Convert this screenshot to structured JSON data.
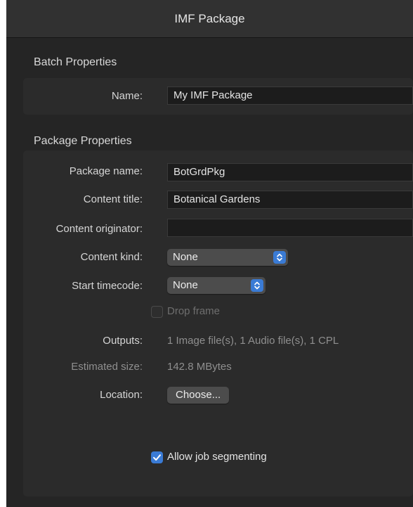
{
  "window": {
    "title": "IMF Package"
  },
  "batch": {
    "header": "Batch Properties",
    "name_label": "Name:",
    "name_value": "My IMF Package"
  },
  "package": {
    "header": "Package Properties",
    "package_name_label": "Package name:",
    "package_name_value": "BotGrdPkg",
    "content_title_label": "Content title:",
    "content_title_value": "Botanical Gardens",
    "content_originator_label": "Content originator:",
    "content_originator_value": "",
    "content_kind_label": "Content kind:",
    "content_kind_value": "None",
    "start_timecode_label": "Start timecode:",
    "start_timecode_value": "None",
    "drop_frame_label": "Drop frame",
    "drop_frame_checked": false,
    "outputs_label": "Outputs:",
    "outputs_value": "1 Image file(s), 1 Audio file(s), 1 CPL",
    "estimated_size_label": "Estimated size:",
    "estimated_size_value": "142.8 MBytes",
    "location_label": "Location:",
    "choose_button_label": "Choose...",
    "allow_segmenting_label": "Allow job segmenting",
    "allow_segmenting_checked": true
  },
  "colors": {
    "accent": "#3a7bd5",
    "background": "#252525",
    "panel": "#2b2b2b"
  },
  "icons": {
    "popup_arrows": "up-down-chevron-icon",
    "check": "checkmark-icon"
  }
}
